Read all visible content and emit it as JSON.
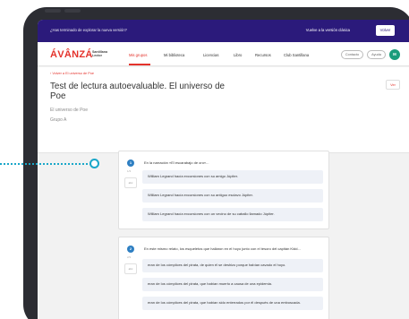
{
  "banner": {
    "text": "¿Has terminado de explorar la nueva versión?",
    "right_text": "Vuelve a la versión clásica",
    "button_label": "Volver"
  },
  "nav": {
    "logo": "ÁVÂNZÁ",
    "logo_sub_line1": "Santillana",
    "logo_sub_line2": "Lector",
    "items": [
      "Mis grupos",
      "Mi biblioteca",
      "Licencias",
      "Libro",
      "Recursos",
      "Club Santillana"
    ],
    "active_index": 0,
    "contact_label": "Contacto",
    "help_label": "Ayuda",
    "avatar_initial": "M"
  },
  "header": {
    "back_link": "‹ Volver a El universo de Poe",
    "title": "Test de lectura autoevaluable. El universo de Poe",
    "subtitle": "El universo de Poe",
    "group": "Grupo A",
    "view_button": "Ver"
  },
  "questions": [
    {
      "number": "1",
      "meta": "1/3",
      "side_button": "abc",
      "text": "En la narración «El escarabajo de oro»...",
      "options": [
        "William Legrand hacía excursiones con su amigo Júpiter.",
        "William Legrand hacía excursiones con su antiguo esclavo Júpiter.",
        "William Legrand hacía excursiones con un vecino de su caballo llamado Júpiter."
      ]
    },
    {
      "number": "2",
      "meta": "2/3",
      "side_button": "abc",
      "text": "En este mismo relato, los esqueletos que hallaron en el hoyo junto con el tesoro del capitán Kidd...",
      "options": [
        "eran de los cómplices del pirata, de quien él se deshizo porque habían cavado el hoyo.",
        "eran de los cómplices del pirata, que habían muerto a causa de una epidemia.",
        "eran de los cómplices del pirata, que habían sido enterrados por él después de una emboscada."
      ]
    }
  ],
  "colors": {
    "banner": "#2b1a7b",
    "brand_red": "#e4322b",
    "question_blue": "#2e7fc2",
    "option_bg": "#eef1f7",
    "callout": "#1aa7c9",
    "avatar": "#1a9c7b"
  }
}
